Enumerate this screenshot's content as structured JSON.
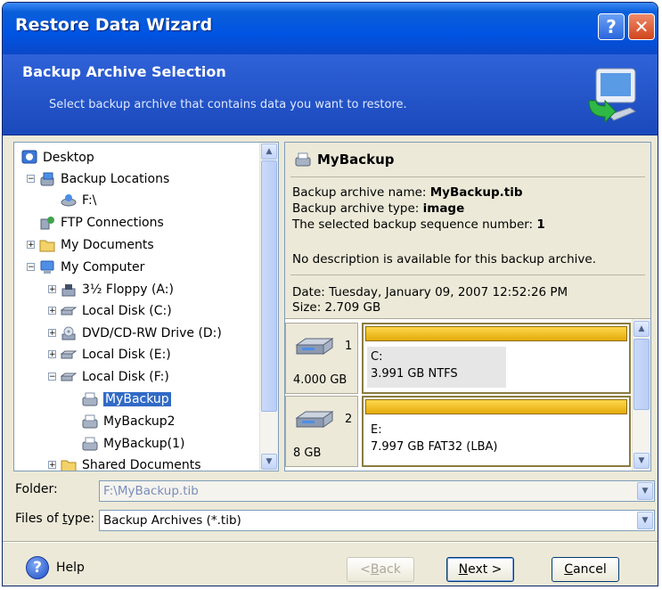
{
  "window": {
    "title": "Restore Data Wizard",
    "help_glyph": "?",
    "close_glyph": "✕"
  },
  "header": {
    "title": "Backup Archive Selection",
    "subtitle": "Select backup archive that contains data you want to restore."
  },
  "tree": {
    "items": [
      {
        "label": "Desktop"
      },
      {
        "label": "Backup Locations"
      },
      {
        "label": "F:\\"
      },
      {
        "label": "FTP Connections"
      },
      {
        "label": "My Documents"
      },
      {
        "label": "My Computer"
      },
      {
        "label": "3½ Floppy (A:)"
      },
      {
        "label": "Local Disk (C:)"
      },
      {
        "label": "DVD/CD-RW Drive (D:)"
      },
      {
        "label": "Local Disk (E:)"
      },
      {
        "label": "Local Disk (F:)"
      },
      {
        "label": "MyBackup"
      },
      {
        "label": "MyBackup2"
      },
      {
        "label": "MyBackup(1)"
      },
      {
        "label": "Shared Documents"
      }
    ],
    "selected": "MyBackup"
  },
  "details": {
    "name": "MyBackup",
    "archive_name_label": "Backup archive name:",
    "archive_name_value": "MyBackup.tib",
    "archive_type_label": "Backup archive type:",
    "archive_type_value": "image",
    "sequence_label": "The selected backup sequence number:",
    "sequence_value": "1",
    "description": "No description is available for this backup archive.",
    "date": "Date: Tuesday, January 09, 2007 12:52:26 PM",
    "size": "Size: 2.709 GB",
    "disks": [
      {
        "number": "1",
        "size": "4.000 GB",
        "partition_letter": "C:",
        "partition_info": "3.991 GB  NTFS"
      },
      {
        "number": "2",
        "size": "8 GB",
        "partition_letter": "E:",
        "partition_info": "7.997 GB  FAT32 (LBA)"
      }
    ]
  },
  "folder": {
    "label": "Folder:",
    "value": "F:\\MyBackup.tib"
  },
  "files_of_type": {
    "label_prefix": "Files of ",
    "label_accel": "t",
    "label_suffix": "ype:",
    "value": "Backup Archives (*.tib)"
  },
  "buttons": {
    "help": "Help",
    "back_prefix": "< ",
    "back_accel": "B",
    "back_suffix": "ack",
    "next_accel": "N",
    "next_suffix": "ext >",
    "cancel_accel": "C",
    "cancel_suffix": "ancel"
  },
  "colors": {
    "title_bar": "#0054e3",
    "header": "#2f62d8",
    "selection": "#316ac5",
    "partition_bar": "#f0c020"
  }
}
